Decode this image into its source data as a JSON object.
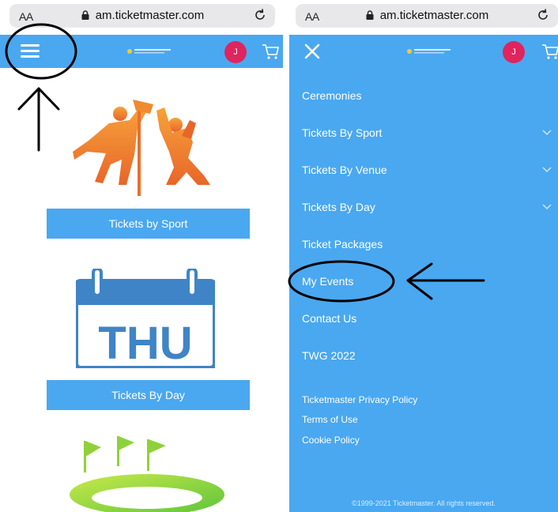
{
  "browser": {
    "aa_label": "AA",
    "url": "am.ticketmaster.com"
  },
  "header": {
    "avatar_initial": "J",
    "logo_name": "The World Games"
  },
  "left_screen": {
    "buttons": {
      "tickets_by_sport": "Tickets by Sport",
      "tickets_by_day": "Tickets By Day"
    },
    "calendar_day": "THU"
  },
  "right_screen": {
    "menu": [
      {
        "label": "Ceremonies",
        "has_chevron": false
      },
      {
        "label": "Tickets By Sport",
        "has_chevron": true
      },
      {
        "label": "Tickets By Venue",
        "has_chevron": true
      },
      {
        "label": "Tickets By Day",
        "has_chevron": true
      },
      {
        "label": "Ticket Packages",
        "has_chevron": false
      },
      {
        "label": "My Events",
        "has_chevron": false
      },
      {
        "label": "Contact Us",
        "has_chevron": false
      },
      {
        "label": "TWG 2022",
        "has_chevron": false
      }
    ],
    "footer_links": [
      "Ticketmaster Privacy Policy",
      "Terms of Use",
      "Cookie Policy"
    ],
    "copyright": "©1999-2021 Ticketmaster. All rights reserved."
  },
  "colors": {
    "brand_blue": "#4aa8f0",
    "avatar_pink": "#e0245e",
    "calendar_blue": "#3f84c6",
    "orange": "#f07a2a",
    "green": "#8fd13a"
  },
  "icons": [
    "lock-icon",
    "reload-icon",
    "hamburger-icon",
    "close-icon",
    "cart-icon",
    "chevron-down-icon"
  ]
}
